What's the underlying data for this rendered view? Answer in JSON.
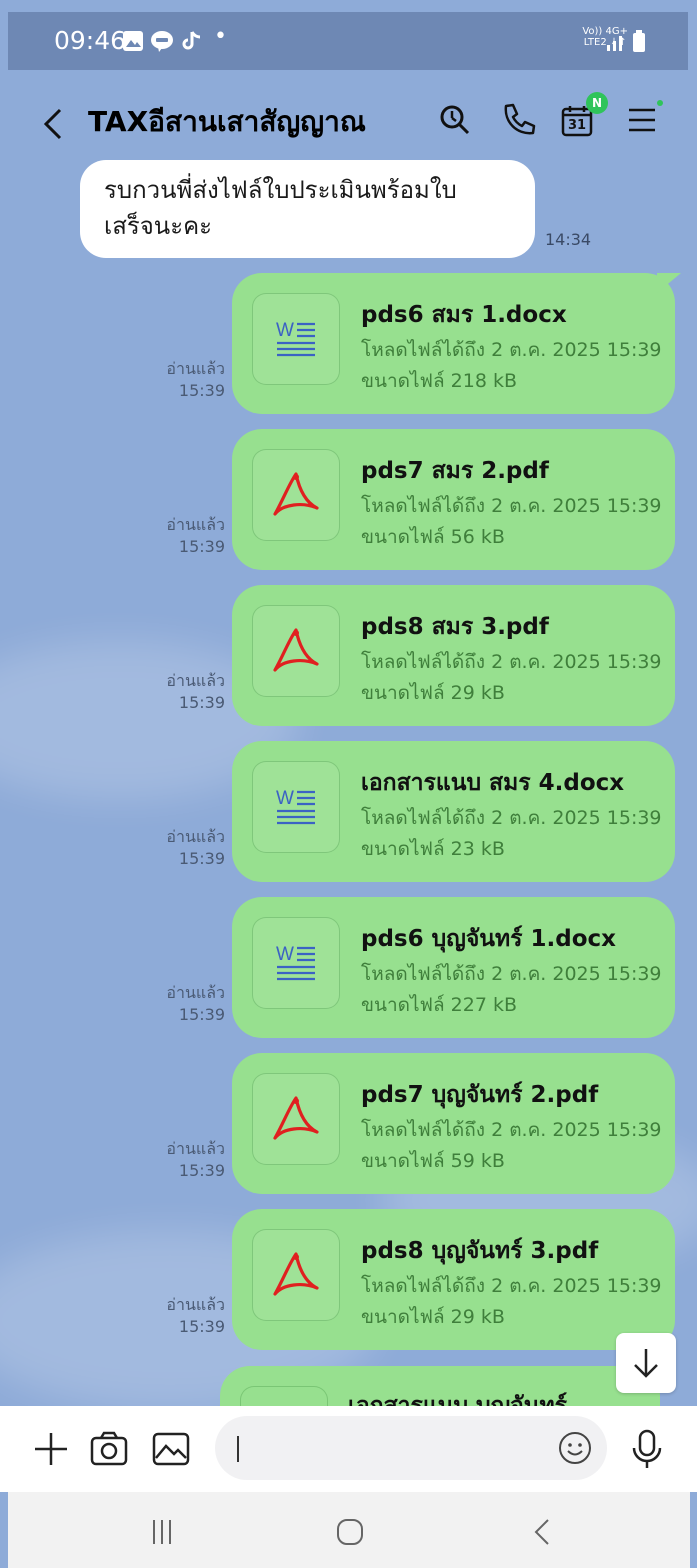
{
  "status_bar": {
    "time": "09:46",
    "dot": "•",
    "net_line1": "Vo)) 4G+",
    "net_line2": "LTE2 ↓↑",
    "icons": [
      "gallery-icon",
      "line-app-icon",
      "tiktok-icon",
      "signal-icon",
      "battery-icon"
    ]
  },
  "header": {
    "title": "TAXอีสานเสาสัญญาณ",
    "calendar_day": "31",
    "badge": "N"
  },
  "messages": {
    "incoming": {
      "line1": "รบกวนพี่ส่งไฟล์ใบประเมินพร้อมใบ",
      "line2": "เสร็จนะคะ",
      "time": "14:34"
    },
    "files": [
      {
        "name": "pds6 สมร 1.docx",
        "type": "word",
        "expiry": "โหลดไฟล์ได้ถึง 2 ต.ค. 2025 15:39",
        "size": "ขนาดไฟล์ 218 kB",
        "read": "อ่านแล้ว",
        "time": "15:39"
      },
      {
        "name": "pds7 สมร 2.pdf",
        "type": "pdf",
        "expiry": "โหลดไฟล์ได้ถึง 2 ต.ค. 2025 15:39",
        "size": "ขนาดไฟล์ 56 kB",
        "read": "อ่านแล้ว",
        "time": "15:39"
      },
      {
        "name": "pds8 สมร 3.pdf",
        "type": "pdf",
        "expiry": "โหลดไฟล์ได้ถึง 2 ต.ค. 2025 15:39",
        "size": "ขนาดไฟล์ 29 kB",
        "read": "อ่านแล้ว",
        "time": "15:39"
      },
      {
        "name": "เอกสารแนบ สมร 4.docx",
        "type": "word",
        "expiry": "โหลดไฟล์ได้ถึง 2 ต.ค. 2025 15:39",
        "size": "ขนาดไฟล์ 23 kB",
        "read": "อ่านแล้ว",
        "time": "15:39"
      },
      {
        "name": "pds6 บุญจันทร์ 1.docx",
        "type": "word",
        "expiry": "โหลดไฟล์ได้ถึง 2 ต.ค. 2025 15:39",
        "size": "ขนาดไฟล์ 227 kB",
        "read": "อ่านแล้ว",
        "time": "15:39"
      },
      {
        "name": "pds7 บุญจันทร์ 2.pdf",
        "type": "pdf",
        "expiry": "โหลดไฟล์ได้ถึง 2 ต.ค. 2025 15:39",
        "size": "ขนาดไฟล์ 59 kB",
        "read": "อ่านแล้ว",
        "time": "15:39"
      },
      {
        "name": "pds8 บุญจันทร์ 3.pdf",
        "type": "pdf",
        "expiry": "โหลดไฟล์ได้ถึง 2 ต.ค. 2025 15:39",
        "size": "ขนาดไฟล์ 29 kB",
        "read": "อ่านแล้ว",
        "time": "15:39"
      }
    ],
    "partial_name": "เอกสารแนบ บุญจันทร์"
  },
  "input_bar": {
    "placeholder": ""
  },
  "colors": {
    "chat_background": "#8eabd8",
    "status_bar": "#6e88b4",
    "sent_bubble": "#97e08f",
    "meta_text": "#3f7f3b",
    "badge": "#2fc45a",
    "pdf_red": "#e02020",
    "word_blue": "#3b62c4"
  }
}
